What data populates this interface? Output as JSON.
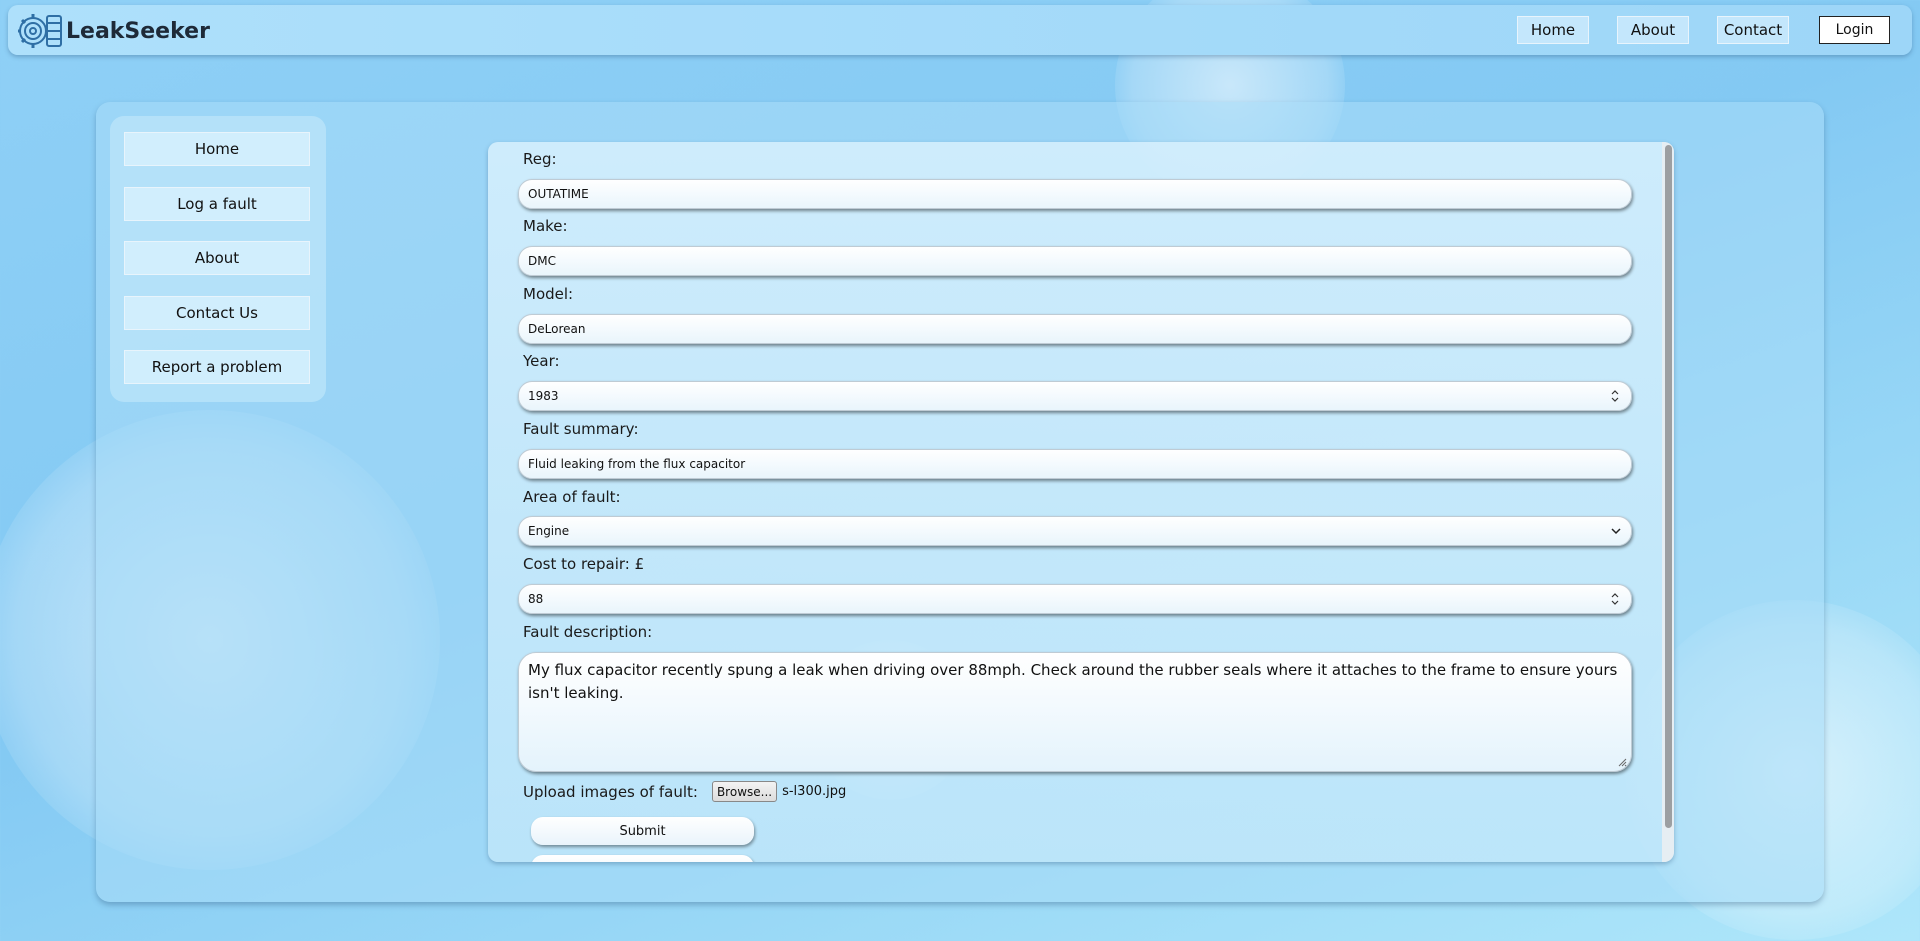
{
  "app": {
    "name": "LeakSeeker",
    "logo_icon": "engine-gear-icon"
  },
  "topnav": {
    "home": "Home",
    "about": "About",
    "contact": "Contact",
    "login": "Login"
  },
  "sidebar": {
    "items": [
      {
        "label": "Home"
      },
      {
        "label": "Log a fault"
      },
      {
        "label": "About"
      },
      {
        "label": "Contact Us"
      },
      {
        "label": "Report a problem"
      }
    ]
  },
  "form": {
    "reg": {
      "label": "Reg:",
      "value": "OUTATIME"
    },
    "make": {
      "label": "Make:",
      "value": "DMC"
    },
    "model": {
      "label": "Model:",
      "value": "DeLorean"
    },
    "year": {
      "label": "Year:",
      "value": "1983"
    },
    "summary": {
      "label": "Fault summary:",
      "value": "Fluid leaking from the flux capacitor"
    },
    "area": {
      "label": "Area of fault:",
      "value": "Engine"
    },
    "cost": {
      "label": "Cost to repair: £",
      "value": "88"
    },
    "description": {
      "label": "Fault description:",
      "value": "My flux capacitor recently spung a leak when driving over 88mph. Check around the rubber seals where it attaches to the frame to ensure yours isn't leaking."
    },
    "upload": {
      "label": "Upload images of fault:",
      "button": "Browse...",
      "filename": "s-l300.jpg"
    },
    "submit": "Submit"
  },
  "colors": {
    "background": "#8fd0f6",
    "panel": "#aadcf8",
    "text": "#1a1a1a"
  }
}
